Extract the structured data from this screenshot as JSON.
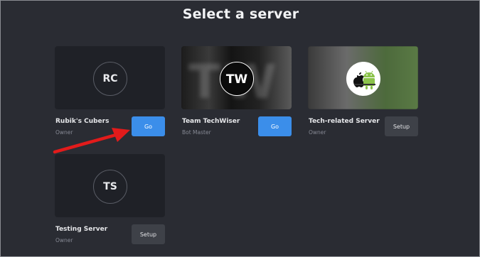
{
  "page": {
    "title": "Select a server"
  },
  "servers": [
    {
      "initials": "RC",
      "name": "Rubik's Cubers",
      "role": "Owner",
      "action": "Go"
    },
    {
      "initials": "TW",
      "name": "Team TechWiser",
      "role": "Bot Master",
      "action": "Go"
    },
    {
      "initials": "",
      "name": "Tech-related Server",
      "role": "Owner",
      "action": "Setup"
    },
    {
      "initials": "TS",
      "name": "Testing Server",
      "role": "Owner",
      "action": "Setup"
    }
  ],
  "colors": {
    "background": "#2a2c33",
    "card": "#1f2127",
    "go_button": "#3b8eea",
    "setup_button": "#3e4148",
    "annotation_arrow": "#e21b1b"
  },
  "icons": {
    "techwiser_logo": "tw-logo-icon",
    "tech_related_logo": "apple-android-icon",
    "annotation": "red-arrow-annotation"
  }
}
